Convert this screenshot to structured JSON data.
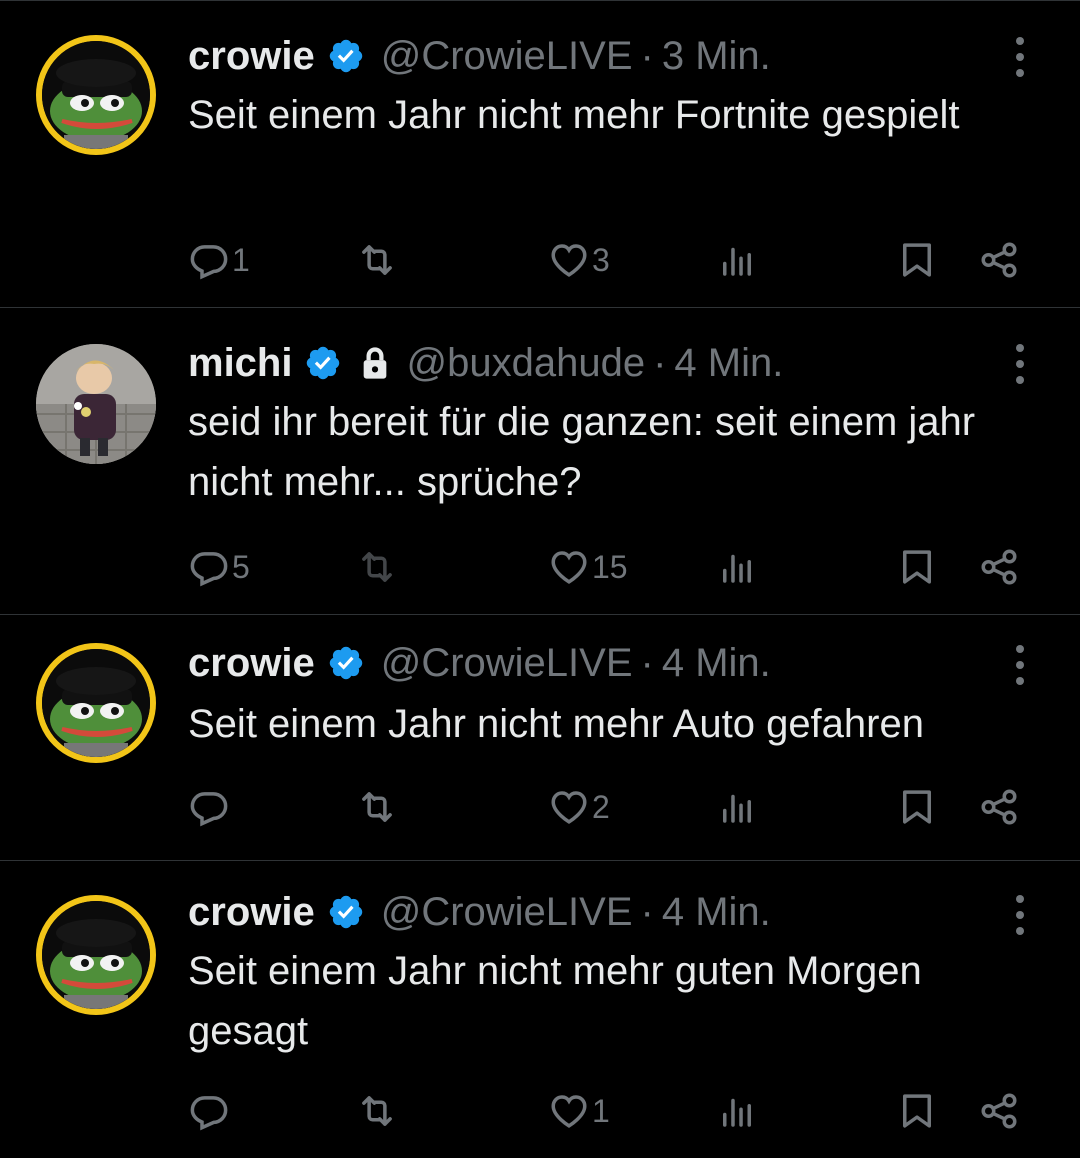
{
  "colors": {
    "background": "#000000",
    "text": "#e7e9ea",
    "muted": "#71767b",
    "verified": "#1d9bf0",
    "divider": "#2f3336",
    "avatar_ring": "#f2c518"
  },
  "tweets": [
    {
      "author": {
        "name": "crowie",
        "handle": "@CrowieLIVE",
        "verified": true,
        "locked": false,
        "avatar": "pepe-avatar"
      },
      "separator": "·",
      "time": "3 Min.",
      "text": "Seit einem Jahr nicht mehr Fortnite gespielt",
      "stats": {
        "replies": "1",
        "retweets": "",
        "likes": "3"
      }
    },
    {
      "author": {
        "name": "michi",
        "handle": "@buxdahude",
        "verified": true,
        "locked": true,
        "avatar": "kid-photo-avatar"
      },
      "separator": "·",
      "time": "4 Min.",
      "text": "seid ihr bereit für die ganzen: seit einem jahr nicht mehr... sprüche?",
      "stats": {
        "replies": "5",
        "retweets": "",
        "likes": "15"
      }
    },
    {
      "author": {
        "name": "crowie",
        "handle": "@CrowieLIVE",
        "verified": true,
        "locked": false,
        "avatar": "pepe-avatar"
      },
      "separator": "·",
      "time": "4 Min.",
      "text": "Seit einem Jahr nicht mehr Auto gefahren",
      "stats": {
        "replies": "",
        "retweets": "",
        "likes": "2"
      }
    },
    {
      "author": {
        "name": "crowie",
        "handle": "@CrowieLIVE",
        "verified": true,
        "locked": false,
        "avatar": "pepe-avatar"
      },
      "separator": "·",
      "time": "4 Min.",
      "text": "Seit einem Jahr nicht mehr guten Morgen gesagt",
      "stats": {
        "replies": "",
        "retweets": "",
        "likes": "1"
      }
    }
  ],
  "icons": [
    "reply-icon",
    "retweet-icon",
    "like-icon",
    "views-icon",
    "bookmark-icon",
    "share-icon",
    "more-icon",
    "verified-badge-icon",
    "lock-icon"
  ]
}
